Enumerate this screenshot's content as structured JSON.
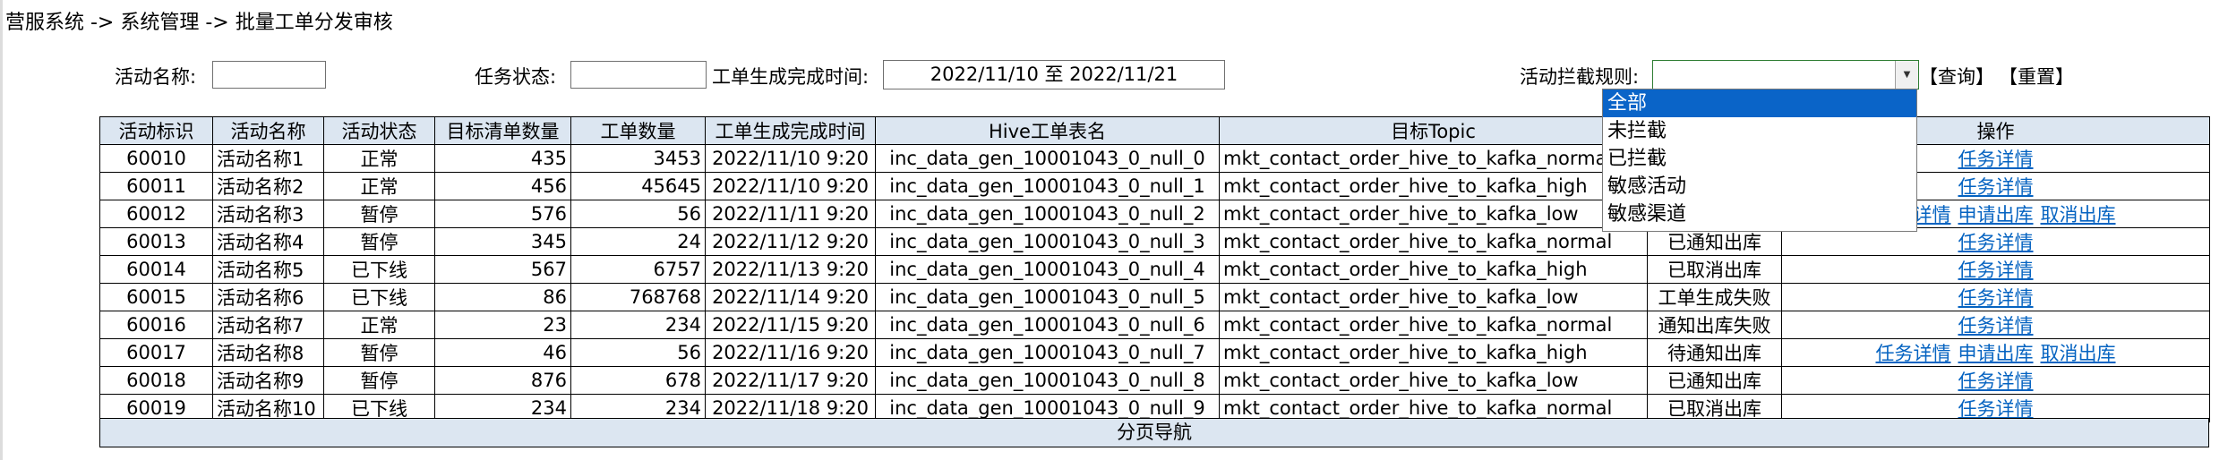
{
  "breadcrumb": "营服系统 -> 系统管理 -> 批量工单分发审核",
  "filters": {
    "activity_name_label": "活动名称:",
    "activity_name_value": "",
    "task_status_label": "任务状态:",
    "task_status_value": "",
    "gen_time_label": "工单生成完成时间:",
    "gen_time_value": "2022/11/10 至 2022/11/21",
    "intercept_rule_label": "活动拦截规则:",
    "intercept_rule_value": "",
    "query_label": "【查询】",
    "reset_label": "【重置】"
  },
  "dropdown": {
    "options": [
      "全部",
      "未拦截",
      "已拦截",
      "敏感活动",
      "敏感渠道"
    ],
    "selected_index": 0
  },
  "table": {
    "columns": [
      "活动标识",
      "活动名称",
      "活动状态",
      "目标清单数量",
      "工单数量",
      "工单生成完成时间",
      "Hive工单表名",
      "目标Topic",
      "",
      "操作"
    ],
    "rows": [
      {
        "id": "60010",
        "name": "活动名称1",
        "status": "正常",
        "target_count": "435",
        "order_count": "3453",
        "time": "2022/11/10 9:20",
        "hive": "inc_data_gen_10001043_0_null_0",
        "topic": "mkt_contact_order_hive_to_kafka_normal",
        "dist_status": "",
        "actions": [
          "任务详情"
        ]
      },
      {
        "id": "60011",
        "name": "活动名称2",
        "status": "正常",
        "target_count": "456",
        "order_count": "45645",
        "time": "2022/11/10 9:20",
        "hive": "inc_data_gen_10001043_0_null_1",
        "topic": "mkt_contact_order_hive_to_kafka_high",
        "dist_status": "",
        "actions": [
          "任务详情"
        ]
      },
      {
        "id": "60012",
        "name": "活动名称3",
        "status": "暂停",
        "target_count": "576",
        "order_count": "56",
        "time": "2022/11/11 9:20",
        "hive": "inc_data_gen_10001043_0_null_2",
        "topic": "mkt_contact_order_hive_to_kafka_low",
        "dist_status": "",
        "actions": [
          "任务详情",
          "申请出库",
          "取消出库"
        ]
      },
      {
        "id": "60013",
        "name": "活动名称4",
        "status": "暂停",
        "target_count": "345",
        "order_count": "24",
        "time": "2022/11/12 9:20",
        "hive": "inc_data_gen_10001043_0_null_3",
        "topic": "mkt_contact_order_hive_to_kafka_normal",
        "dist_status": "已通知出库",
        "actions": [
          "任务详情"
        ]
      },
      {
        "id": "60014",
        "name": "活动名称5",
        "status": "已下线",
        "target_count": "567",
        "order_count": "6757",
        "time": "2022/11/13 9:20",
        "hive": "inc_data_gen_10001043_0_null_4",
        "topic": "mkt_contact_order_hive_to_kafka_high",
        "dist_status": "已取消出库",
        "actions": [
          "任务详情"
        ]
      },
      {
        "id": "60015",
        "name": "活动名称6",
        "status": "已下线",
        "target_count": "86",
        "order_count": "768768",
        "time": "2022/11/14 9:20",
        "hive": "inc_data_gen_10001043_0_null_5",
        "topic": "mkt_contact_order_hive_to_kafka_low",
        "dist_status": "工单生成失败",
        "actions": [
          "任务详情"
        ]
      },
      {
        "id": "60016",
        "name": "活动名称7",
        "status": "正常",
        "target_count": "23",
        "order_count": "234",
        "time": "2022/11/15 9:20",
        "hive": "inc_data_gen_10001043_0_null_6",
        "topic": "mkt_contact_order_hive_to_kafka_normal",
        "dist_status": "通知出库失败",
        "actions": [
          "任务详情"
        ]
      },
      {
        "id": "60017",
        "name": "活动名称8",
        "status": "暂停",
        "target_count": "46",
        "order_count": "56",
        "time": "2022/11/16 9:20",
        "hive": "inc_data_gen_10001043_0_null_7",
        "topic": "mkt_contact_order_hive_to_kafka_high",
        "dist_status": "待通知出库",
        "actions": [
          "任务详情",
          "申请出库",
          "取消出库"
        ]
      },
      {
        "id": "60018",
        "name": "活动名称9",
        "status": "暂停",
        "target_count": "876",
        "order_count": "678",
        "time": "2022/11/17 9:20",
        "hive": "inc_data_gen_10001043_0_null_8",
        "topic": "mkt_contact_order_hive_to_kafka_low",
        "dist_status": "已通知出库",
        "actions": [
          "任务详情"
        ]
      },
      {
        "id": "60019",
        "name": "活动名称10",
        "status": "已下线",
        "target_count": "234",
        "order_count": "234",
        "time": "2022/11/18 9:20",
        "hive": "inc_data_gen_10001043_0_null_9",
        "topic": "mkt_contact_order_hive_to_kafka_normal",
        "dist_status": "已取消出库",
        "actions": [
          "任务详情"
        ]
      }
    ]
  },
  "pager_label": "分页导航",
  "colors": {
    "header_bg": "#dce6f1",
    "link": "#0563c1",
    "selected_option": "#0a64c8",
    "combo_border": "#2e7d32"
  }
}
